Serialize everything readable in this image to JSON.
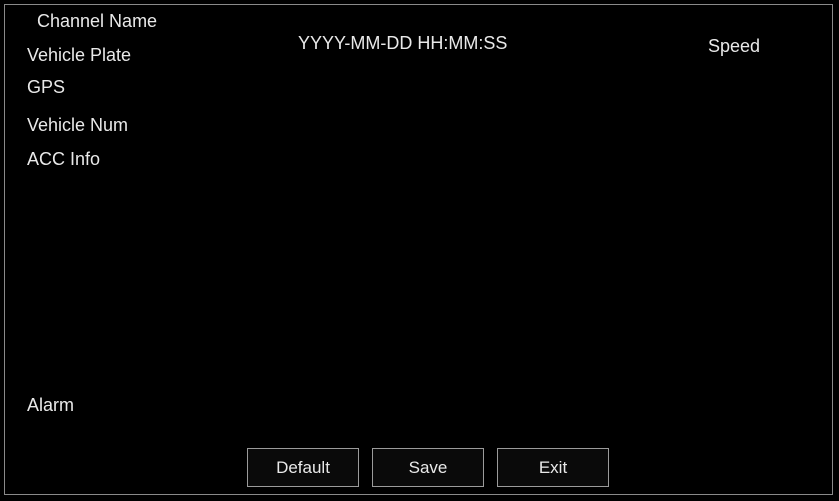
{
  "osd": {
    "channel_name": "Channel Name",
    "vehicle_plate": "Vehicle Plate",
    "datetime": "YYYY-MM-DD HH:MM:SS",
    "speed": "Speed",
    "gps": "GPS",
    "vehicle_num": "Vehicle Num",
    "acc_info": "ACC Info",
    "alarm": "Alarm"
  },
  "buttons": {
    "default_label": "Default",
    "save_label": "Save",
    "exit_label": "Exit"
  },
  "colors": {
    "background": "#000000",
    "text": "#e9e9e9",
    "border": "#9b9b9b"
  }
}
